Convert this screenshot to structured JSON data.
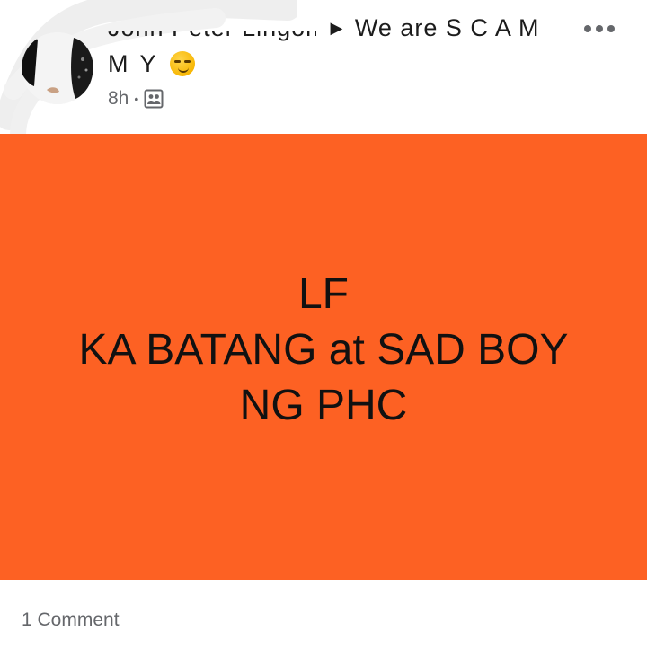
{
  "post": {
    "author_name": "John Peter Lingon",
    "group_name_part1": "We are S C A M",
    "group_name_part2": "M Y",
    "separator_icon": "triangle-right-icon",
    "time": "8h",
    "meta_dot": "•",
    "audience_icon": "group-icon",
    "more_icon": "more-horizontal-icon",
    "emoji_icon": "smirking-face-emoji"
  },
  "banner": {
    "background_color": "#fd6123",
    "lines": [
      "LF",
      "KA BATANG at SAD BOY",
      "NG PHC"
    ]
  },
  "footer": {
    "comment_count": "1 Comment"
  }
}
